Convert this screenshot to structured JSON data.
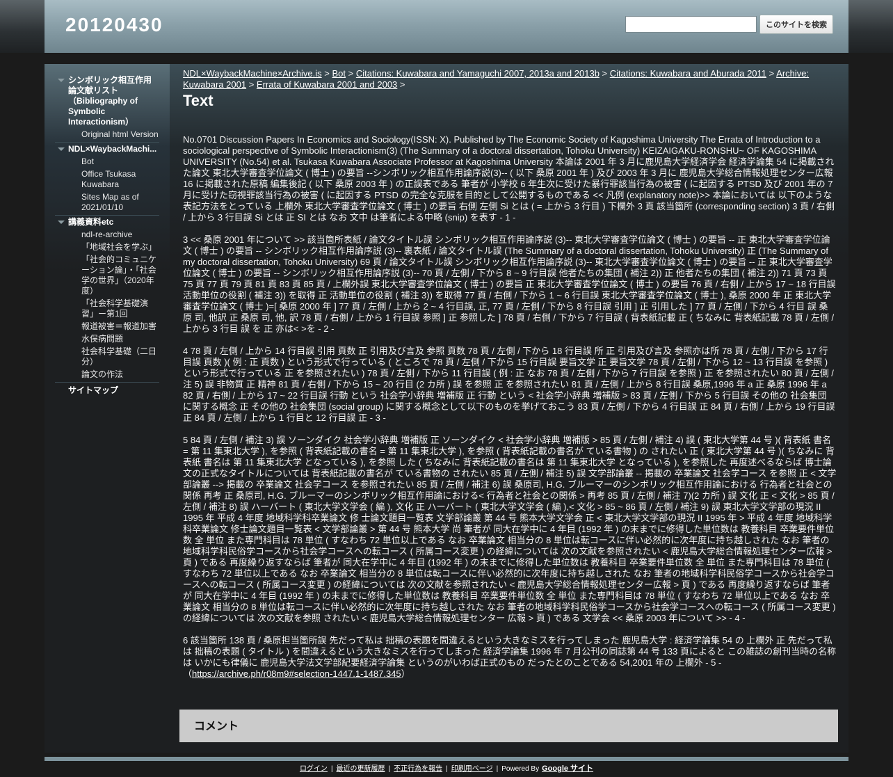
{
  "header": {
    "site_title": "20120430",
    "search_placeholder": "",
    "search_button": "このサイトを検索"
  },
  "sidebar": {
    "groups": [
      {
        "label": "シンボリック相互作用論文献リスト（Bibliography of Symbolic Interactionism）",
        "items": [
          "Original html Version"
        ]
      },
      {
        "label": "NDL×WaybackMachine×Archive.is",
        "label_shown": "NDL×WaybackMachi...",
        "items": [
          "Bot",
          "Office Tsukasa Kuwabara",
          "Sites Map as of 2021/01/10"
        ]
      },
      {
        "label": "講義資料etc",
        "items": [
          "ndl-re-archive",
          "「地域社会を学ぶ」",
          "「社会的コミュニケーション論」・「社会学の世界」（2020年度）",
          "「社会科学基礎演習」ー第1回",
          "報道被害＝報道加害",
          "水俣病問題",
          "社会科学基礎（二日分）",
          "論文の作法"
        ]
      }
    ],
    "sitemap": "サイトマップ"
  },
  "breadcrumb": {
    "items": [
      "NDL×WaybackMachine×Archive.is",
      "Bot",
      "Citations: Kuwabara and Yamaguchi 2007, 2013a and 2013b",
      "Citations: Kuwabara and Aburada 2011",
      "Archive: Kuwabara 2001",
      "Errata of Kuwabara 2001 and 2003"
    ],
    "separator": ">"
  },
  "page": {
    "title": "Text",
    "paragraphs": [
      "No.0701 Discussion Papers In Economics and Sociology(ISSN: X). Published by The Economic Society of Kagoshima University The Errata of Introduction to a sociological perspective of Symbolic Interactionism(3) (The Summary of a doctoral dissertation, Tohoku University) KEIZAIGAKU-RONSHU~ OF KAGOSHIMA UNIVERSITY (No.54) et al. Tsukasa Kuwabara Associate Professor at Kagoshima University 本論は 2001 年 3 月に鹿児島大学経済学会 経済学論集 54 に掲載された論文 東北大学審査学位論文 ( 博士 ) の要旨 --シンボリック相互作用論序説(3)-- ( 以下 桑原 2001 年 ) 及び 2003 年 3 月に 鹿児島大学総合情報処理センター広報 16 に掲載された原稿 編集後記 ( 以下 桑原 2003 年 ) の正誤表である 筆者が 小学校 6 年生次に受けた暴行罪該当行為の被害 ( に起因する PTSD 及び 2001 年の 7 月に受けた窃視罪該当行為の被害 ( に起因する PTSD の完全な克服を目的として公開するものである << 凡例 (explanatory note)>> 本論においては 以下のような表記方法をとっている 上欄外 東北大学審査学位論文 ( 博士 ) の要旨 右側 左側 Si とは ( = 上から 3 行目 ) 下欄外 3 頁 該当箇所 (corresponding section) 3 頁 / 右側 / 上から 3 行目誤 Si とは 正 SI とは なお 文中 は筆者による中略 (snip) を表す - 1 -",
      "3 << 桑原 2001 年について >> 該当箇所表紙 / 論文タイトル誤 シンボリック相互作用論序説 (3)-- 東北大学審査学位論文 ( 博士 ) の要旨 -- 正 東北大学審査学位論文 ( 博士 ) の要旨 -- シンボリック相互作用論序説 (3)-- 裏表紙 / 論文タイトル誤 (The Summary of a doctoral dissertation, Tohoku University) 正 (The Summary of my doctoral dissertation, Tohoku University) 69 頁 / 論文タイトル誤 シンボリック相互作用論序説 (3)-- 東北大学審査学位論文 ( 博士 ) の要旨 -- 正 東北大学審査学位論文 ( 博士 ) の要旨 -- シンボリック相互作用論序説 (3)-- 70 頁 / 左側 / 下から 8 ~ 9 行目誤 他者たちの集団 ( 補注 2)) 正 他者たちの集団 ( 補注 2)) 71 頁 73 頁 75 頁 77 頁 79 頁 81 頁 83 頁 85 頁 / 上欄外誤 東北大学審査学位論文 ( 博士 ) の要旨 正 東北大学審査学位論文 ( 博士 ) の要旨 76 頁 / 右側 / 上から 17 ~ 18 行目誤 活動単位の役割 ( 補注 3)) を取得 正 活動単位の役割 ( 補注 3)) を取得 77 頁 / 右側 / 下から 1 ~ 6 行目誤 東北大学審査学位論文 ( 博士 ), 桑原 2000 年 正 東北大学審査学位論文 ( 博士 )=[ 桑原 2000 年 ] 77 頁 / 左側 / 上から 2 ~ 4 行目誤, 正, 77 頁 / 左側 / 下から 8 行目誤 引用 ] 正 引用した ] 77 頁 / 左側 / 下から 4 行目 誤 桑原 司, 他訳 正 桑原 司, 他, 訳 78 頁 / 右側 / 上から 1 行目誤 参照 ] 正 参照した ] 78 頁 / 右側 / 下から 7 行目誤 ( 背表紙記載 正 ( ちなみに 背表紙記載 78 頁 / 左側 / 上から 3 行目 誤 を 正 亦は< >を - 2 -",
      "4 78 頁 / 左側 / 上から 14 行目誤 引用 頁数 正 引用及び言及 参照 頁数 78 頁 / 左側 / 下から 18 行目誤 所 正 引用及び言及 参照亦は所 78 頁 / 左側 / 下から 17 行目誤 頁数 )( 例 : 正 頁数 ) という形式で行っている ( ところで 78 頁 / 左側 / 下から 15 行目誤 要旨文学 正 要旨文学 78 頁 / 左側 / 下から 12 ~ 13 行目誤 を参照 ) という形式で行っている 正 を参照されたい ) 78 頁 / 左側 / 下から 11 行目誤 ( 例 : 正 なお 78 頁 / 左側 / 下から 7 行目誤 を参照 ) 正 を参照されたい 80 頁 / 左側 / 注 5) 誤 非物質 正 精神 81 頁 / 右側 / 下から 15 ~ 20 行目 (2 カ所 ) 誤 を参照 正 を参照されたい 81 頁 / 左側 / 上から 8 行目誤 桑原,1996 年 a 正 桑原 1996 年 a 82 頁 / 右側 / 上から 17 ~ 22 行目誤 行動 という 社会学小辞典 増補版 正 行動 という < 社会学小辞典 増補版 > 83 頁 / 左側 / 下から 5 行目誤 その他の 社会集団 に関する概念 正 その他の 社会集団 (social group) に関する概念として以下のものを挙げておこう 83 頁 / 左側 / 下から 4 行目誤 正 84 頁 / 右側 / 上から 19 行目誤 正 84 頁 / 左側 / 上から 1 行目と 12 行目誤 正 - 3 -",
      "5 84 頁 / 左側 / 補注 3) 誤 ソーンダイク 社会学小辞典 増補版 正 ソーンダイク < 社会学小辞典 増補版 > 85 頁 / 左側 / 補注 4) 誤 ( 東北大学第 44 号 )( 背表紙 書名 = 第 11 集東北大学 ), を参照 ( 背表紙記載の書名 = 第 11 集東北大学 ), を参照 ( 背表紙記載の書名が ている書物 ) の されたい 正 ( 東北大学第 44 号 )( ちなみに 背表紙 書名は 第 11 集東北大学 となっている ), を参照 した ( ちなみに 背表紙記載の書名は 第 11 集東北大学 となっている ), を参照した 再度述べるならば 博士論文の正式なタイトルについては 背表紙記載の書名が ている書物の されたい 85 頁 / 左側 / 補注 5) 誤 文学部論叢 -- 掲載の 卒業論文 社会学コース を参照 正 < 文学部論叢 --> 掲載の 卒業論文 社会学コース を参照されたい 85 頁 / 左側 / 補注 6) 誤 桑原司, H.G. ブルーマーのシンボリック相互作用論における 行為者と社会との関係 再考 正 桑原司, H.G. ブルーマーのシンボリック相互作用論における< 行為者と社会との関係 > 再考 85 頁 / 左側 / 補注 7)(2 カ所 ) 誤 文化 正 < 文化 > 85 頁 / 左側 / 補注 8) 誤 ハーバート ( 東北大学文学会 ( 編 ), 文化 正 ハーバート ( 東北大学文学会 ( 編 ),< 文化 > 85 ~ 86 頁 / 左側 / 補注 9) 誤 東北大学文学部の現況 II 1995 年 平成 4 年度 地域科学科卒業論文 修 士論文題目一覧表 文学部論叢 第 44 号 熊本大学文学会 正 < 東北大学文学部の現況 II 1995 年 > 平成 4 年度 地域科学科卒業論文 修士論文題目一覧表 < 文学部論叢 > 第 44 号 熊本大学 尚 筆者が 同大在学中に 4 年目 (1992 年 ) の末までに修得した単位数は 教養科目 卒業要件単位数 全 単位 また専門科目は 78 単位 ( すなわち 72 単位以上である なお 卒業論文 相当分の 8 単位は転コースに伴い必然的に次年度に持ち越しされた なお 筆者の地域科学科民俗学コースから社会学コースへの転コース ( 所属コース変更 ) の経緯については 次の文献を参照されたい < 鹿児島大学総合情報処理センター広報 > 頁 ) である 再度繰り返すならば 筆者が 同大在学中に 4 年目 (1992 年 ) の末までに修得した単位数は 教養科目 卒業要件単位数 全 単位 また専門科目は 78 単位 ( すなわち 72 単位以上である なお 卒業論文 相当分の 8 単位は転コースに伴い必然的に次年度に持ち越しされた なお 筆者の地域科学科民俗学コースから社会学コースへの転コース ( 所属コース変更 ) の経緯については 次の文献を参照されたい < 鹿児島大学総合情報処理センター広報 > 頁 ) である 再度繰り返すならば 筆者が 同大在学中に 4 年目 (1992 年 ) の末までに修得した単位数は 教養科目 卒業要件単位数 全 単位 また専門科目は 78 単位 ( すなわち 72 単位以上である なお 卒業論文 相当分の 8 単位は転コースに伴い必然的に次年度に持ち越しされた なお 筆者の地域科学科民俗学コースから社会学コースへの転コース ( 所属コース変更 ) の経緯については 次の文献を参照 されたい < 鹿児島大学総合情報処理センター 広報 > 頁 ) である 文学会 << 桑原 2003 年について >> - 4 -",
      "6 該当箇所 138 頁 / 桑原担当箇所誤 先だって私は 拙稿の表題を間違えるという大きなミスを行ってしまった 鹿児島大学 : 経済学論集 54 の 上欄外 正 先だって私は 拙稿の表題 ( タイトル ) を間違えるという大きなミスを行ってしまった 経済学論集 1996 年 7 月公刊の同誌第 44 号 133 頁によると この雑誌の創刊当時の名称は いかにも律儀に 鹿児島大学法文学部紀要経済学論集 というのがいわば正式のもの だったとのことである 54,2001 年の 上欄外 - 5 -"
    ],
    "source_open": "（",
    "source_link": "https://archive.ph/r08m9#selection-1447.1-1487.345",
    "source_close": "）"
  },
  "comments": {
    "title": "コメント"
  },
  "footer": {
    "login": "ログイン",
    "recent": "最近の更新履歴",
    "report": "不正行為を報告",
    "print": "印刷用ページ",
    "powered": "Powered By",
    "google": "Google サイト",
    "sep": "|"
  }
}
